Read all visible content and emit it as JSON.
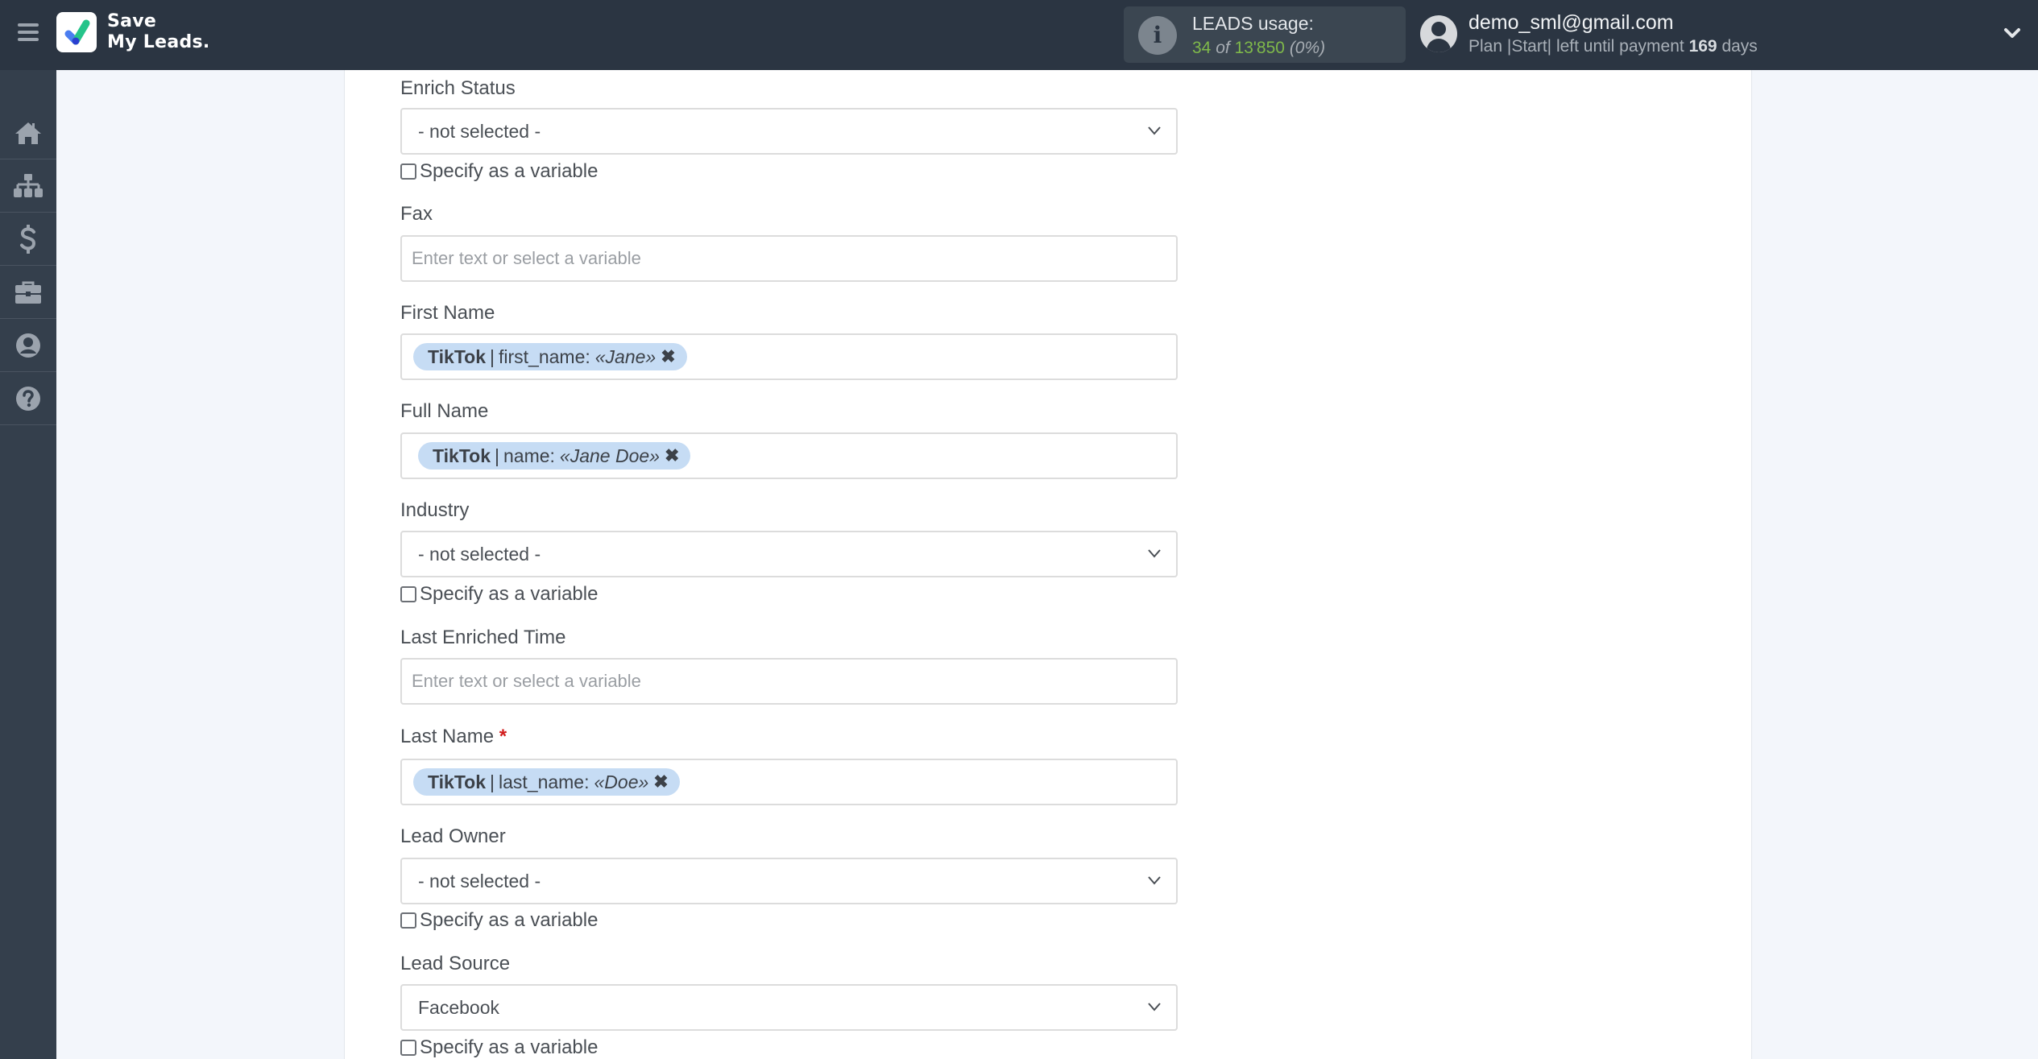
{
  "header": {
    "logo_line1": "Save",
    "logo_line2": "My Leads.",
    "usage_title": "LEADS usage:",
    "usage_used": "34",
    "usage_of": "of",
    "usage_total": "13'850",
    "usage_percent": "(0%)",
    "user_email": "demo_sml@gmail.com",
    "plan_prefix": "Plan |Start| left until payment",
    "plan_days": "169",
    "plan_suffix": "days"
  },
  "sidebar": {
    "items": [
      {
        "icon": "home-icon"
      },
      {
        "icon": "sitemap-icon"
      },
      {
        "icon": "dollar-icon"
      },
      {
        "icon": "briefcase-icon"
      },
      {
        "icon": "user-icon"
      },
      {
        "icon": "help-icon"
      }
    ]
  },
  "form": {
    "checkbox_label": "Specify as a variable",
    "placeholder": "Enter text or select a variable",
    "fields": {
      "enrich_status": {
        "label": "Enrich Status",
        "value": "- not selected -"
      },
      "fax": {
        "label": "Fax"
      },
      "first_name": {
        "label": "First Name",
        "chip_source": "TikTok",
        "chip_sep": "|",
        "chip_field": "first_name:",
        "chip_value": "«Jane»",
        "chip_remove": "✖"
      },
      "full_name": {
        "label": "Full Name",
        "chip_source": "TikTok",
        "chip_sep": "|",
        "chip_field": "name:",
        "chip_value": "«Jane Doe»",
        "chip_remove": "✖"
      },
      "industry": {
        "label": "Industry",
        "value": "- not selected -"
      },
      "last_enriched_time": {
        "label": "Last Enriched Time"
      },
      "last_name": {
        "label": "Last Name",
        "required_mark": "*",
        "chip_source": "TikTok",
        "chip_sep": "|",
        "chip_field": "last_name:",
        "chip_value": "«Doe»",
        "chip_remove": "✖"
      },
      "lead_owner": {
        "label": "Lead Owner",
        "value": "- not selected -"
      },
      "lead_source": {
        "label": "Lead Source",
        "value": "Facebook"
      }
    }
  }
}
